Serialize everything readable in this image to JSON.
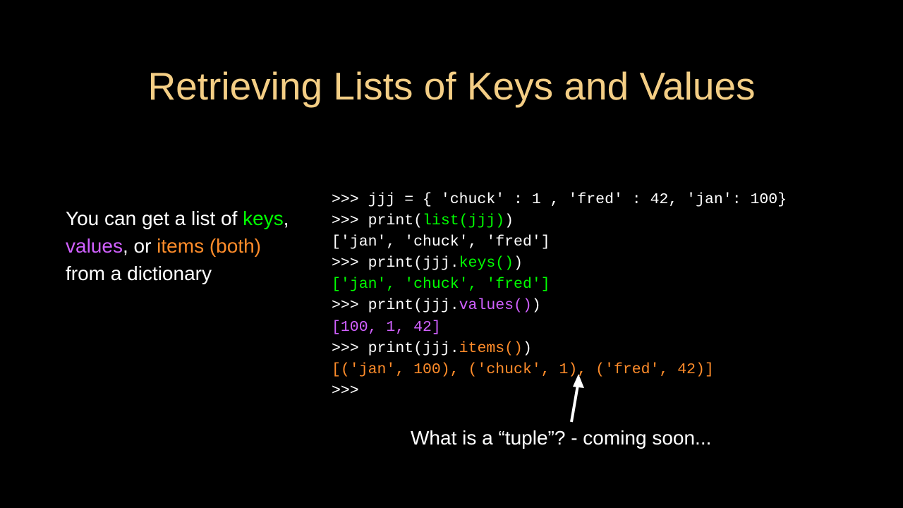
{
  "title": "Retrieving Lists of Keys and Values",
  "body": {
    "part1": "You can get a list of ",
    "keys": "keys",
    "comma1": ", ",
    "values": "values",
    "comma2": ", or ",
    "items": "items (both)",
    "part2": " from a dictionary"
  },
  "code": {
    "l1": ">>> jjj = { 'chuck' : 1 , 'fred' : 42, 'jan': 100}",
    "l2a": ">>> print(",
    "l2b": "list(jjj)",
    "l2c": ")",
    "l3": "['jan', 'chuck', 'fred']",
    "l4a": ">>> print(jjj.",
    "l4b": "keys()",
    "l4c": ")",
    "l5": "['jan', 'chuck', 'fred']",
    "l6a": ">>> print(jjj.",
    "l6b": "values()",
    "l6c": ")",
    "l7": "[100, 1, 42]",
    "l8a": ">>> print(jjj.",
    "l8b": "items()",
    "l8c": ")",
    "l9": "[('jan', 100), ('chuck', 1), ('fred', 42)]",
    "l10": ">>> "
  },
  "footnote": "What is a “tuple”? - coming soon..."
}
